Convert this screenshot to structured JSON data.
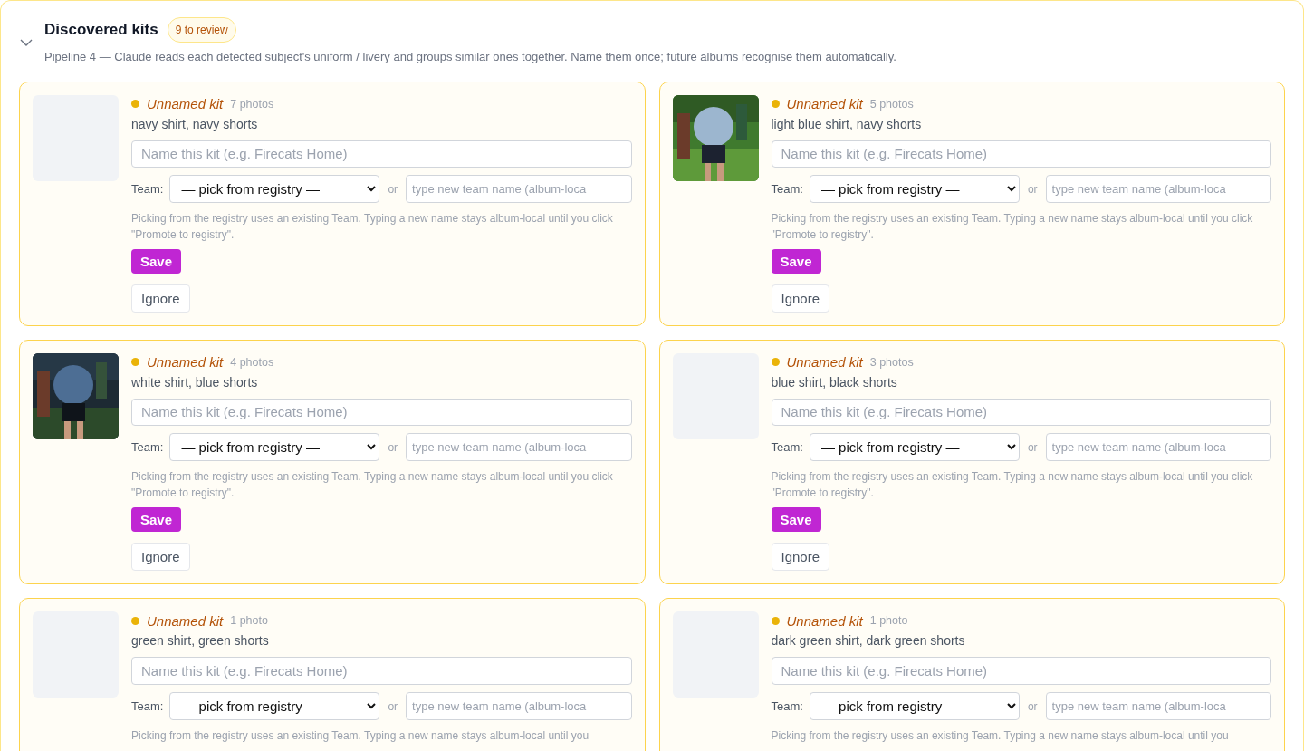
{
  "section": {
    "title": "Discovered kits",
    "badge": "9 to review",
    "expanded": true,
    "description": "Pipeline 4 — Claude reads each detected subject's uniform / livery and groups similar ones together. Name them once; future albums recognise them automatically."
  },
  "kits": [
    {
      "name": "Unnamed kit",
      "count": "7 photos",
      "summary": "navy shirt, navy shorts",
      "name_placeholder": "Name this kit (e.g. Firecats Home)",
      "team_label": "Team:",
      "team_select": "— pick from registry —",
      "or": "or",
      "team_placeholder": "type new team name (album-loca",
      "help": "Picking from the registry uses an existing Team. Typing a new name stays album-local until you click \"Promote to registry\".",
      "save": "Save",
      "ignore": "Ignore"
    },
    {
      "name": "Unnamed kit",
      "count": "5 photos",
      "summary": "light blue shirt, navy shorts",
      "name_placeholder": "Name this kit (e.g. Firecats Home)",
      "team_label": "Team:",
      "team_select": "— pick from registry —",
      "or": "or",
      "team_placeholder": "type new team name (album-loca",
      "help": "Picking from the registry uses an existing Team. Typing a new name stays album-local until you click \"Promote to registry\".",
      "save": "Save",
      "ignore": "Ignore"
    },
    {
      "name": "Unnamed kit",
      "count": "4 photos",
      "summary": "white shirt, blue shorts",
      "name_placeholder": "Name this kit (e.g. Firecats Home)",
      "team_label": "Team:",
      "team_select": "— pick from registry —",
      "or": "or",
      "team_placeholder": "type new team name (album-loca",
      "help": "Picking from the registry uses an existing Team. Typing a new name stays album-local until you click \"Promote to registry\".",
      "save": "Save",
      "ignore": "Ignore"
    },
    {
      "name": "Unnamed kit",
      "count": "3 photos",
      "summary": "blue shirt, black shorts",
      "name_placeholder": "Name this kit (e.g. Firecats Home)",
      "team_label": "Team:",
      "team_select": "— pick from registry —",
      "or": "or",
      "team_placeholder": "type new team name (album-loca",
      "help": "Picking from the registry uses an existing Team. Typing a new name stays album-local until you click \"Promote to registry\".",
      "save": "Save",
      "ignore": "Ignore"
    },
    {
      "name": "Unnamed kit",
      "count": "1 photo",
      "summary": "green shirt, green shorts",
      "name_placeholder": "Name this kit (e.g. Firecats Home)",
      "team_label": "Team:",
      "team_select": "— pick from registry —",
      "or": "or",
      "team_placeholder": "type new team name (album-loca",
      "help": "Picking from the registry uses an existing Team. Typing a new name stays album-local until you"
    },
    {
      "name": "Unnamed kit",
      "count": "1 photo",
      "summary": "dark green shirt, dark green shorts",
      "name_placeholder": "Name this kit (e.g. Firecats Home)",
      "team_label": "Team:",
      "team_select": "— pick from registry —",
      "or": "or",
      "team_placeholder": "type new team name (album-loca",
      "help": "Picking from the registry uses an existing Team. Typing a new name stays album-local until you"
    }
  ]
}
